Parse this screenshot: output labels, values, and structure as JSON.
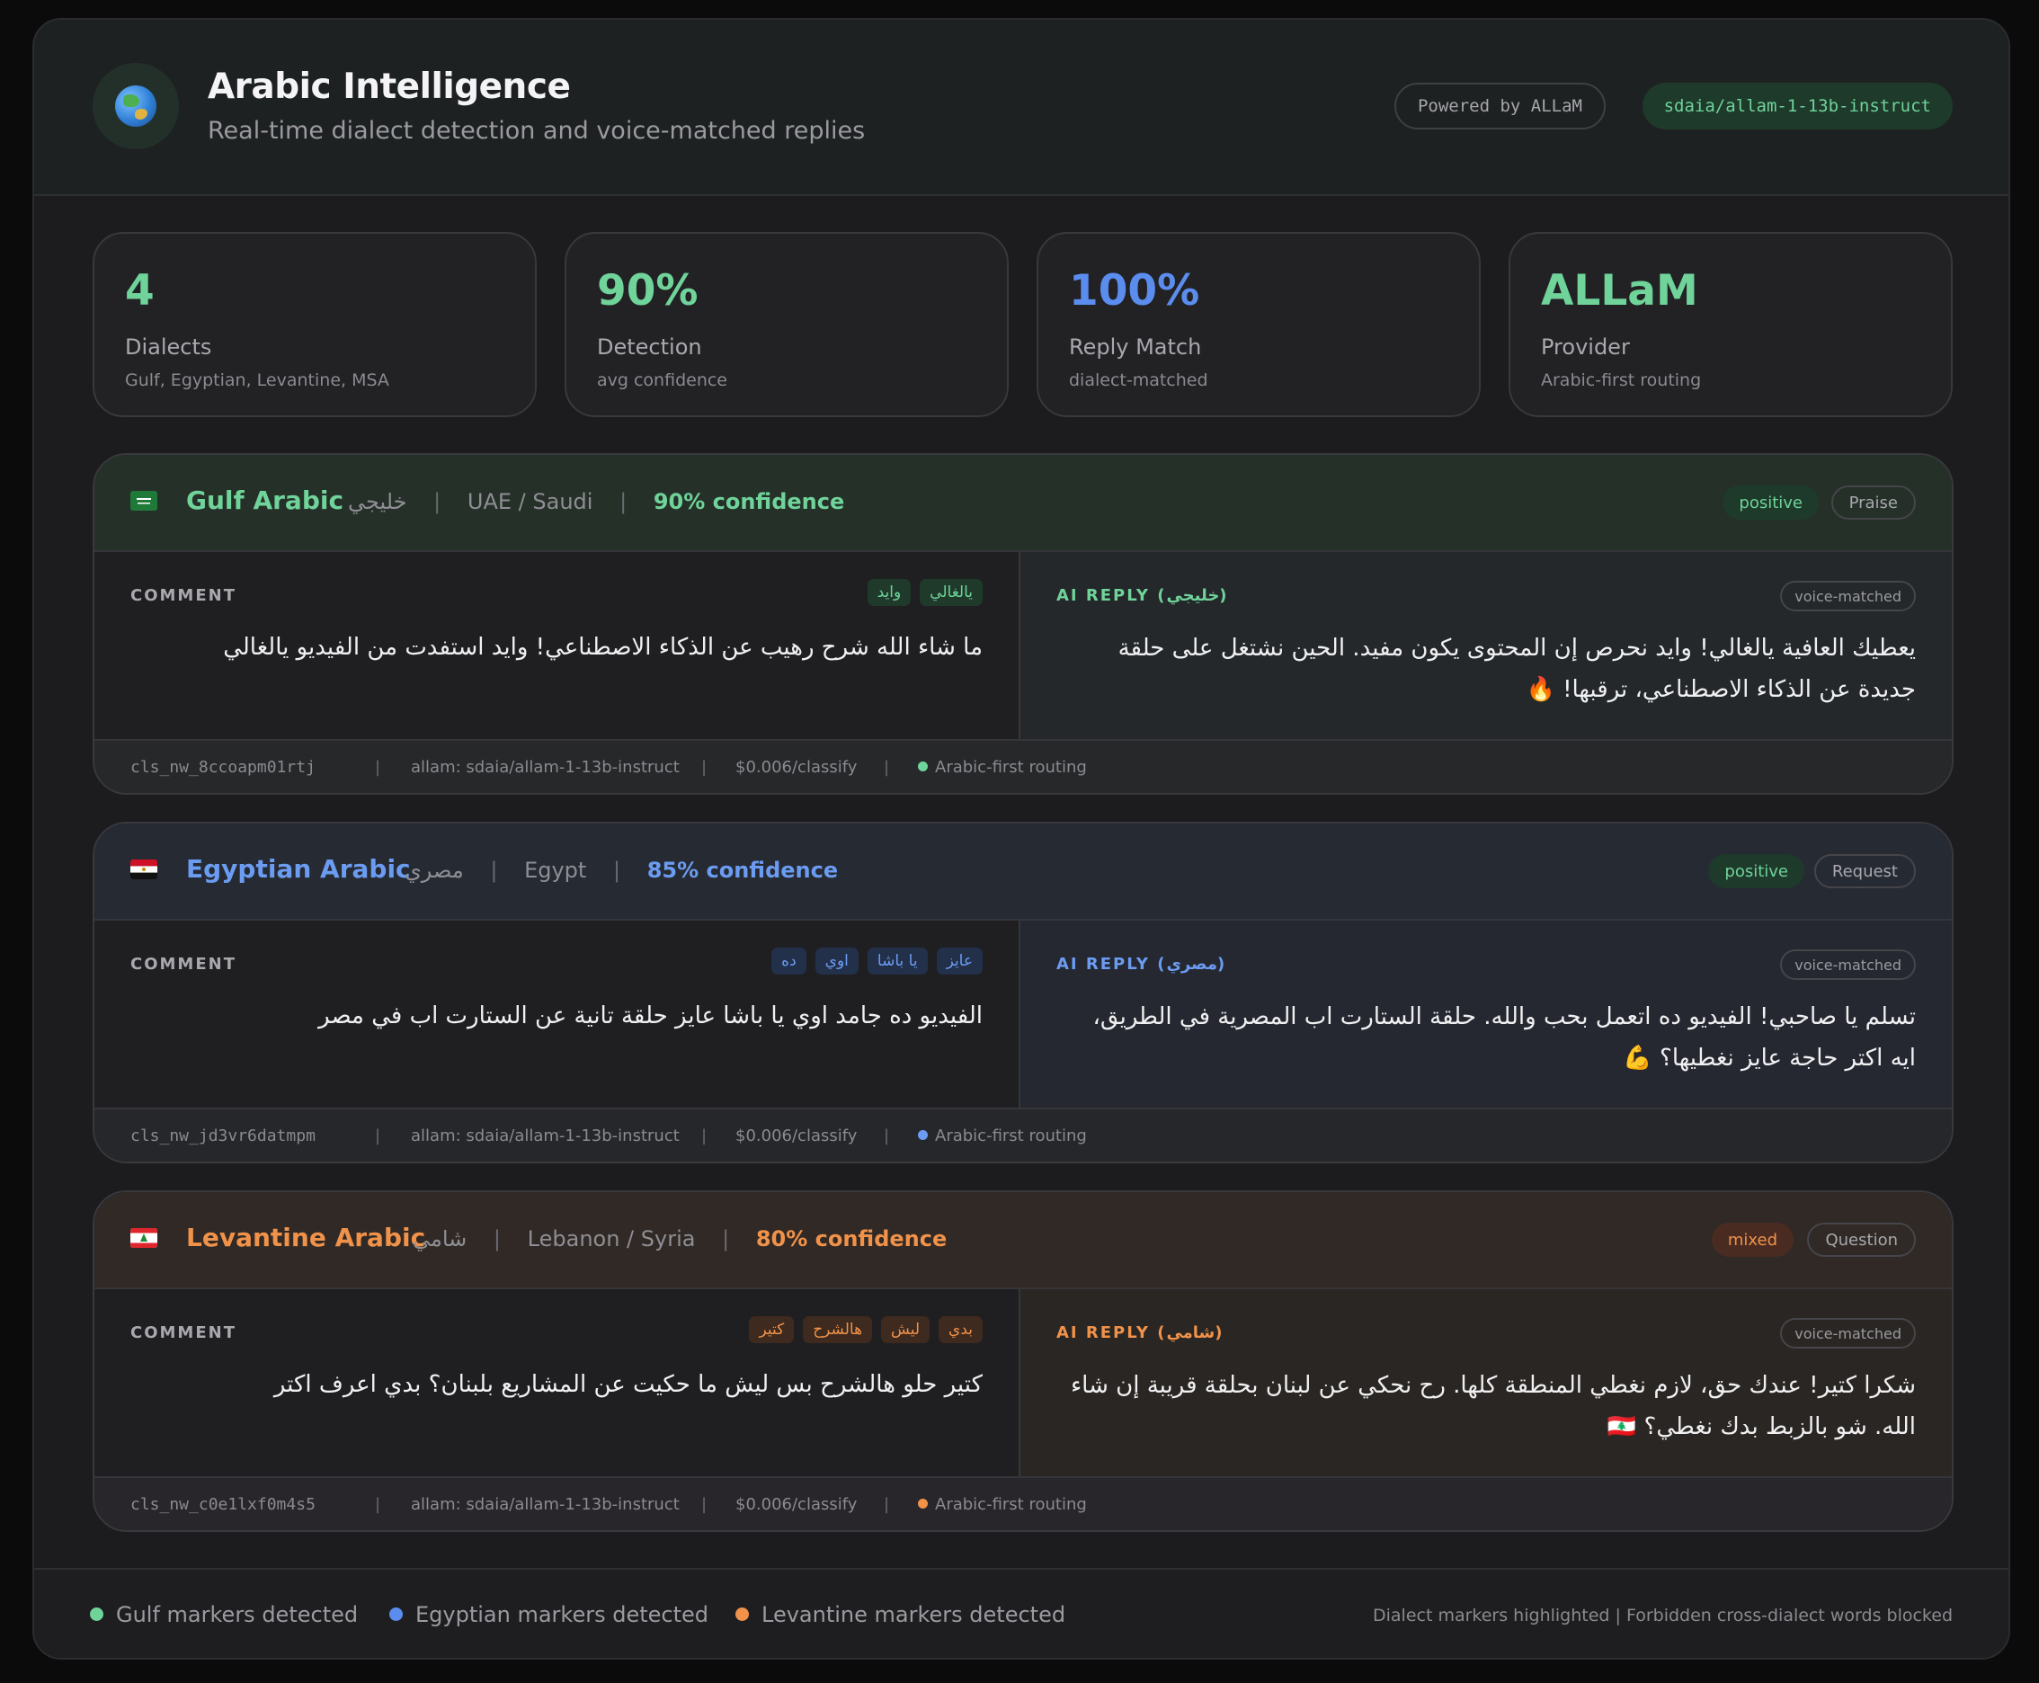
{
  "header": {
    "title": "Arabic Intelligence",
    "subtitle": "Real-time dialect detection and voice-matched replies",
    "powered": "Powered by ALLaM",
    "model": "sdaia/allam-1-13b-instruct",
    "logo_icon": "globe-icon"
  },
  "stats": [
    {
      "value": "4",
      "label": "Dialects",
      "sub": "Gulf, Egyptian, Levantine, MSA",
      "color": "#6fd39a"
    },
    {
      "value": "90%",
      "label": "Detection",
      "sub": "avg confidence",
      "color": "#6fd39a"
    },
    {
      "value": "100%",
      "label": "Reply Match",
      "sub": "dialect-matched",
      "color": "#5b8def"
    },
    {
      "value": "ALLaM",
      "label": "Provider",
      "sub": "Arabic-first routing",
      "color": "#6fd39a"
    }
  ],
  "cards": [
    {
      "name": "Gulf Arabic",
      "native": "خليجي",
      "region": "UAE / Saudi",
      "confidence": "90% confidence",
      "sentiment": "positive",
      "type": "Praise",
      "comment_label": "COMMENT",
      "markers": [
        "يالغالي",
        "وايد"
      ],
      "comment": "ما شاء الله شرح رهيب عن الذكاء الاصطناعي! وايد استفدت من الفيديو يالغالي",
      "reply_label": "AI REPLY (خليجي)",
      "voice": "voice-matched",
      "reply": "يعطيك العافية يالغالي! وايد نحرص إن المحتوى يكون مفيد. الحين نشتغل على حلقة جديدة عن الذكاء الاصطناعي، ترقبها! 🔥",
      "id": "cls_nw_8ccoapm01rtj",
      "model": "allam: sdaia/allam-1-13b-instruct",
      "cost": "$0.006/classify",
      "routing": "Arabic-first routing",
      "accent": "#6fd39a",
      "flag_icon": "saudi-flag-icon"
    },
    {
      "name": "Egyptian Arabic",
      "native": "مصري",
      "region": "Egypt",
      "confidence": "85% confidence",
      "sentiment": "positive",
      "type": "Request",
      "comment_label": "COMMENT",
      "markers": [
        "عايز",
        "يا باشا",
        "اوي",
        "ده"
      ],
      "comment": "الفيديو ده جامد اوي يا باشا عايز حلقة تانية عن الستارت اب في مصر",
      "reply_label": "AI REPLY (مصري)",
      "voice": "voice-matched",
      "reply": "تسلم يا صاحبي! الفيديو ده اتعمل بحب والله. حلقة الستارت اب المصرية في الطريق، ايه اكتر حاجة عايز نغطيها؟ 💪",
      "id": "cls_nw_jd3vr6datmpm",
      "model": "allam: sdaia/allam-1-13b-instruct",
      "cost": "$0.006/classify",
      "routing": "Arabic-first routing",
      "accent": "#6b9cf2",
      "flag_icon": "egypt-flag-icon"
    },
    {
      "name": "Levantine Arabic",
      "native": "شامي",
      "region": "Lebanon / Syria",
      "confidence": "80% confidence",
      "sentiment": "mixed",
      "type": "Question",
      "comment_label": "COMMENT",
      "markers": [
        "بدي",
        "ليش",
        "هالشرح",
        "كتير"
      ],
      "comment": "كتير حلو هالشرح بس ليش ما حكيت عن المشاريع بلبنان؟ بدي اعرف اكتر",
      "reply_label": "AI REPLY (شامي)",
      "voice": "voice-matched",
      "reply": "شكرا كتير! عندك حق، لازم نغطي المنطقة كلها. رح نحكي عن لبنان بحلقة قريبة إن شاء الله. شو بالزبط بدك نغطي؟ 🇱🇧",
      "id": "cls_nw_c0e1lxf0m4s5",
      "model": "allam: sdaia/allam-1-13b-instruct",
      "cost": "$0.006/classify",
      "routing": "Arabic-first routing",
      "accent": "#f0924a",
      "flag_icon": "lebanon-flag-icon"
    }
  ],
  "footer": {
    "legend": [
      "Gulf markers detected",
      "Egyptian markers detected",
      "Levantine markers detected"
    ],
    "note": "Dialect markers highlighted | Forbidden cross-dialect words blocked"
  }
}
